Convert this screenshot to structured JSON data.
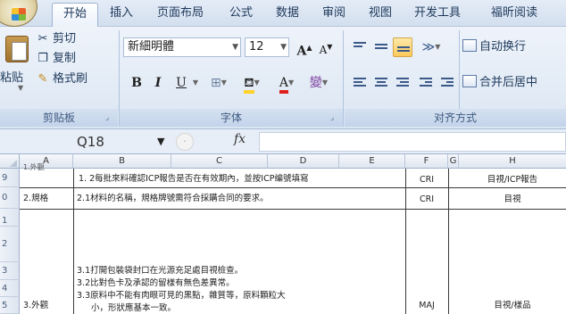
{
  "ribbon_tabs": [
    {
      "label": "开始",
      "active": true
    },
    {
      "label": "插入",
      "active": false
    },
    {
      "label": "页面布局",
      "active": false
    },
    {
      "label": "公式",
      "active": false
    },
    {
      "label": "数据",
      "active": false
    },
    {
      "label": "审阅",
      "active": false
    },
    {
      "label": "视图",
      "active": false
    },
    {
      "label": "开发工具",
      "active": false
    },
    {
      "label": "福昕阅读",
      "active": false
    }
  ],
  "clipboard": {
    "paste": "粘贴",
    "cut": "剪切",
    "copy": "复制",
    "format_painter": "格式刷",
    "group_label": "剪贴板"
  },
  "font": {
    "font_name": "新細明體",
    "font_size": "12",
    "grow": "A",
    "shrink": "A",
    "bold": "B",
    "italic": "I",
    "underline": "U",
    "font_color_letter": "A",
    "phonetic": "變",
    "group_label": "字体"
  },
  "alignment": {
    "wrap_text": "自动换行",
    "merge_center": "合并后居中",
    "group_label": "对齐方式"
  },
  "formula_bar": {
    "name_box": "Q18",
    "fx": "fx",
    "formula": ""
  },
  "columns": [
    "A",
    "B",
    "C",
    "D",
    "E",
    "F",
    "G",
    "H"
  ],
  "rows": [
    {
      "num": "9",
      "a": "1.外觀",
      "b": "1. 2每批來料確認ICP報告是否在有效期內，並按ICP编號填寫",
      "f": "CRI",
      "h": "目視/ICP報告"
    },
    {
      "num": "0",
      "a": "2.規格",
      "b": "2.1材料的名稱，規格牌號需符合採購合同的要求。",
      "f": "CRI",
      "h": "目視"
    },
    {
      "num": "1",
      "a": "",
      "b": "",
      "f": "",
      "h": ""
    },
    {
      "num": "2",
      "a": "",
      "b": "",
      "f": "",
      "h": ""
    },
    {
      "num": "3",
      "a": "",
      "b": "3.1打開包裝袋封口在光源充足處目視檢查。",
      "f": "",
      "h": ""
    },
    {
      "num": "4",
      "a": "",
      "b": "3.2比對色卡及承認的留樣有無色差異常。",
      "f": "",
      "h": ""
    },
    {
      "num": "5",
      "a": "3.外觀",
      "b": "3.3原料中不能有肉眼可見的黑點，雜質等，原料顆粒大",
      "f": "MAJ",
      "h": "目視/樣品"
    },
    {
      "num": "",
      "a": "",
      "b": "小，形狀應基本一致。",
      "f": "",
      "h": ""
    }
  ]
}
